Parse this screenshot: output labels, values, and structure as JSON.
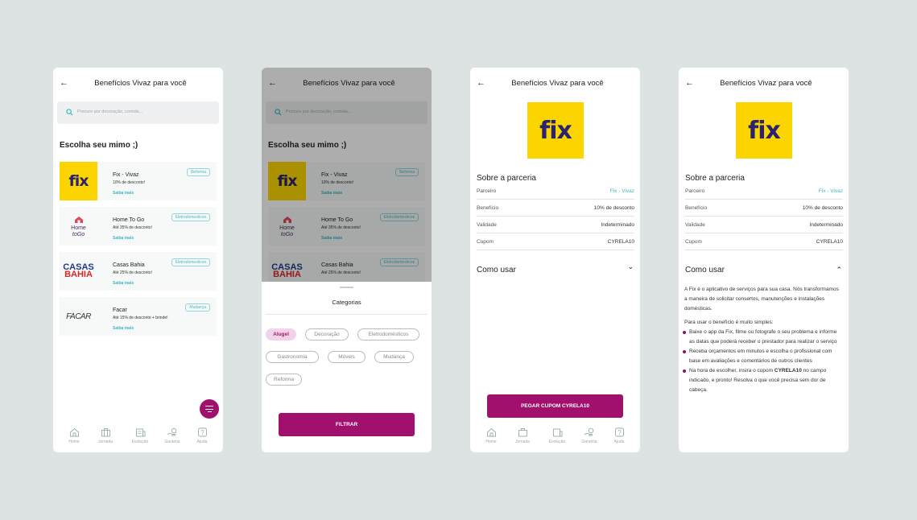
{
  "header": {
    "title": "Benefícios Vivaz para você"
  },
  "search": {
    "placeholder": "Procure por decoração, comida..."
  },
  "list": {
    "title": "Escolha seu mimo ;)",
    "more_label": "Saiba mais",
    "items": [
      {
        "name": "Fix - Vivaz",
        "desc": "10% de desconto!",
        "tag": "Reforma",
        "logo": "fix"
      },
      {
        "name": "Home To Go",
        "desc": "Até 35% de desconto!",
        "tag": "Eletrodomesticos",
        "logo": "Home To Go"
      },
      {
        "name": "Casas Bahia",
        "desc": "Até 25% de desconto!",
        "tag": "Eletrodomesticos",
        "logo": "Casas Bahia"
      },
      {
        "name": "Facar",
        "desc": "Até 15% de desconto + brinde!",
        "tag": "Mudança",
        "logo": "FACAR"
      }
    ]
  },
  "logos": {
    "fix": "fix",
    "home1": "Home",
    "home2": "toGo",
    "casas1": "CASAS",
    "casas2": "BAHIA",
    "facar": "FACAR"
  },
  "tabbar": [
    {
      "label": "Home",
      "icon": "home-icon"
    },
    {
      "label": "Jornada",
      "icon": "briefcase-icon"
    },
    {
      "label": "Evolução",
      "icon": "building-icon"
    },
    {
      "label": "Garantia",
      "icon": "hand-coin-icon"
    },
    {
      "label": "Ajuda",
      "icon": "help-icon"
    }
  ],
  "filter": {
    "title": "Categorias",
    "chips": [
      "Alugel",
      "Decoração",
      "Eletrodomésticos",
      "Gastronomia",
      "Móveis",
      "Mudança",
      "Reforma"
    ],
    "selected": "Alugel",
    "button": "FILTRAR"
  },
  "detail": {
    "about_title": "Sobre a parceria",
    "rows": [
      {
        "key": "Parceiro",
        "value": "Fix - Vivaz"
      },
      {
        "key": "Benefício",
        "value": "10% de desconto"
      },
      {
        "key": "Validade",
        "value": "Indeterminado"
      },
      {
        "key": "Cupom",
        "value": "CYRELA10"
      }
    ],
    "howto_title": "Como usar",
    "cta": "PEGAR CUPOM CYRELA10",
    "howto": {
      "intro": "A Fix é o aplicativo de serviços para sua casa. Nós transformamos a maneira de solicitar consertos, manutenções e instalações domésticas.",
      "steps_intro": "Para usar o benefício é muito simples:",
      "step1": "Baixe o app da Fix, filme ou fotografe o seu problema e informe as datas que poderá receber o prestador para realizar o serviço",
      "step2": "Receba orçamentos em minutos e escolha o profissional com base em avaliações e comentários de outros clientes",
      "step3_a": "Na hora de escolher, insira o cupom ",
      "step3_code": "CYRELA10",
      "step3_b": " no campo indicado, e pronto! Resolva o que você precisa sem dor de cabeça."
    }
  },
  "colors": {
    "primary": "#a0106c",
    "accent": "#3bb6c4",
    "fix_yellow": "#fcd500",
    "fix_navy": "#2a2370"
  }
}
